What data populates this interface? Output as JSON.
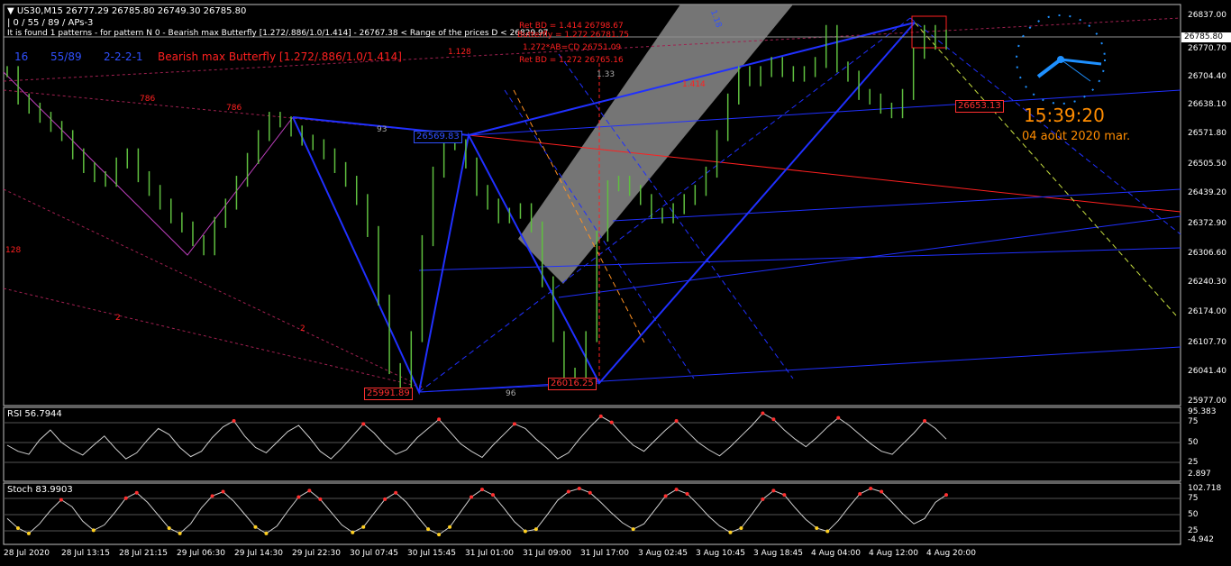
{
  "header": {
    "symbol_line": "US30,M15  26777.29 26785.80 26749.30 26785.80",
    "indicator_line": "| 0 / 55 / 89 / APs-3",
    "pattern_line": "It is found 1 patterns  -  for pattern N 0 - Bearish max Butterfly [1.272/.886/1.0/1.414] - 26767.38 < Range of the prices D < 26829.97",
    "params": [
      "16",
      "55/89",
      "2-2-2-1"
    ],
    "pattern_name": "Bearish max Butterfly [1.272/.886/1.0/1.414]"
  },
  "annotations": {
    "ret_labels": [
      "Ret BD = 1.414  26798.67",
      "Butterfly = 1.272  26781.75",
      "1.272*AB=CD  26751.09",
      "Ret BD = 1.272  26765.16"
    ],
    "fib_labels": [
      "1.128",
      "786",
      "786",
      "93",
      "96",
      "1.33",
      "1.414",
      "1.18",
      "2",
      "2",
      "128"
    ],
    "boxes": [
      "25991.89",
      "26016.25",
      "26569.83",
      "26653.13"
    ]
  },
  "clock": {
    "time": "15:39:20",
    "date": "04 août 2020 mar."
  },
  "colors": {
    "candles": "#5fbf3f",
    "pattern": "#2030ff",
    "magenta": "#c040c0",
    "rsi": "#d0d0d0",
    "accent": "#ff8c00"
  },
  "chart_data": [
    {
      "type": "line",
      "title": "US30,M15",
      "x_labels": [
        "28 Jul 2020",
        "28 Jul 13:15",
        "28 Jul 21:15",
        "29 Jul 06:30",
        "29 Jul 14:30",
        "29 Jul 22:30",
        "30 Jul 07:45",
        "30 Jul 15:45",
        "31 Jul 01:00",
        "31 Jul 09:00",
        "31 Jul 17:00",
        "3 Aug 02:45",
        "3 Aug 10:45",
        "3 Aug 18:45",
        "4 Aug 04:00",
        "4 Aug 12:00",
        "4 Aug 20:00"
      ],
      "y_ticks": [
        "26837.00",
        "26770.70",
        "26704.40",
        "26638.10",
        "26571.80",
        "26505.50",
        "26439.20",
        "26372.90",
        "26306.60",
        "26240.30",
        "26174.00",
        "26107.70",
        "26041.40",
        "25977.00"
      ],
      "ylim": [
        25977.0,
        26837.0
      ],
      "current_price": "26785.80",
      "series": [
        {
          "name": "US30,M15",
          "values": [
            26700,
            26640,
            26620,
            26600,
            26580,
            26560,
            26520,
            26490,
            26470,
            26460,
            26500,
            26520,
            26470,
            26440,
            26410,
            26380,
            26360,
            26330,
            26310,
            26370,
            26410,
            26460,
            26510,
            26560,
            26600,
            26590,
            26570,
            26550,
            26540,
            26520,
            26490,
            26460,
            26420,
            26350,
            26200,
            26050,
            26000,
            26120,
            26330,
            26480,
            26550,
            26540,
            26500,
            26440,
            26410,
            26380,
            26390,
            26400,
            26360,
            26240,
            26120,
            26040,
            26020,
            26120,
            26340,
            26450,
            26460,
            26440,
            26420,
            26390,
            26380,
            26400,
            26420,
            26440,
            26480,
            26560,
            26640,
            26700,
            26680,
            26700,
            26720,
            26700,
            26690,
            26700,
            26720,
            26790,
            26710,
            26690,
            26650,
            26640,
            26620,
            26610,
            26650,
            26740,
            26790,
            26760,
            26780
          ]
        }
      ]
    },
    {
      "type": "line",
      "title": "RSI 56.7944",
      "y_ticks": [
        "95.383",
        "75",
        "50",
        "25",
        "2.897"
      ],
      "ylim": [
        2.897,
        95.383
      ],
      "series": [
        {
          "name": "RSI",
          "values": [
            48,
            40,
            36,
            55,
            68,
            52,
            42,
            35,
            48,
            60,
            44,
            30,
            38,
            55,
            70,
            62,
            45,
            33,
            40,
            58,
            72,
            80,
            60,
            45,
            38,
            52,
            66,
            74,
            58,
            40,
            30,
            44,
            60,
            76,
            64,
            48,
            36,
            42,
            58,
            70,
            82,
            66,
            50,
            40,
            32,
            48,
            62,
            76,
            70,
            56,
            44,
            30,
            38,
            56,
            72,
            86,
            78,
            62,
            48,
            40,
            54,
            68,
            80,
            66,
            52,
            42,
            34,
            46,
            60,
            74,
            90,
            82,
            68,
            56,
            46,
            58,
            72,
            84,
            74,
            62,
            50,
            40,
            36,
            50,
            64,
            80,
            70,
            56
          ]
        }
      ]
    },
    {
      "type": "line",
      "title": "Stoch 83.9903",
      "y_ticks": [
        "102.718",
        "75",
        "50",
        "25",
        "-4.942"
      ],
      "ylim": [
        -4.942,
        102.718
      ],
      "series": [
        {
          "name": "Stoch",
          "values": [
            40,
            22,
            12,
            30,
            55,
            75,
            62,
            35,
            18,
            28,
            52,
            78,
            88,
            70,
            46,
            22,
            12,
            30,
            60,
            82,
            90,
            72,
            48,
            24,
            12,
            26,
            54,
            80,
            92,
            76,
            52,
            28,
            14,
            24,
            50,
            76,
            88,
            70,
            44,
            20,
            10,
            24,
            52,
            80,
            94,
            84,
            60,
            34,
            16,
            20,
            46,
            74,
            90,
            96,
            88,
            70,
            50,
            32,
            20,
            30,
            56,
            82,
            94,
            86,
            66,
            44,
            26,
            14,
            22,
            48,
            76,
            92,
            84,
            60,
            38,
            22,
            16,
            36,
            62,
            86,
            96,
            90,
            70,
            48,
            30,
            40,
            70,
            84
          ]
        }
      ]
    }
  ]
}
